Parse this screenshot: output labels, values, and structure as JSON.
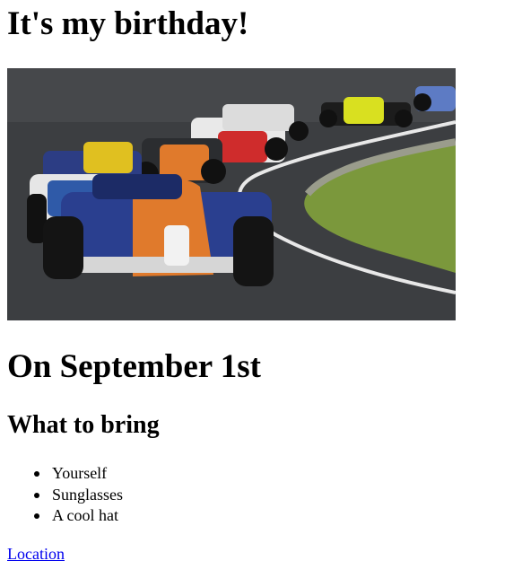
{
  "page": {
    "title": "It's my birthday!",
    "hero_image": "indycar-race-photo",
    "date_heading": "On September 1st",
    "bring_heading": "What to bring",
    "bring_items": [
      "Yourself",
      "Sunglasses",
      "A cool hat"
    ],
    "location_link": "Location"
  },
  "colors": {
    "text": "#000000",
    "link": "#0000ee",
    "background": "#ffffff",
    "track": "#3d3f42",
    "grass": "#7d9a3e",
    "lead_car": "#e07a2c",
    "lead_car_secondary": "#2f5aa8"
  }
}
